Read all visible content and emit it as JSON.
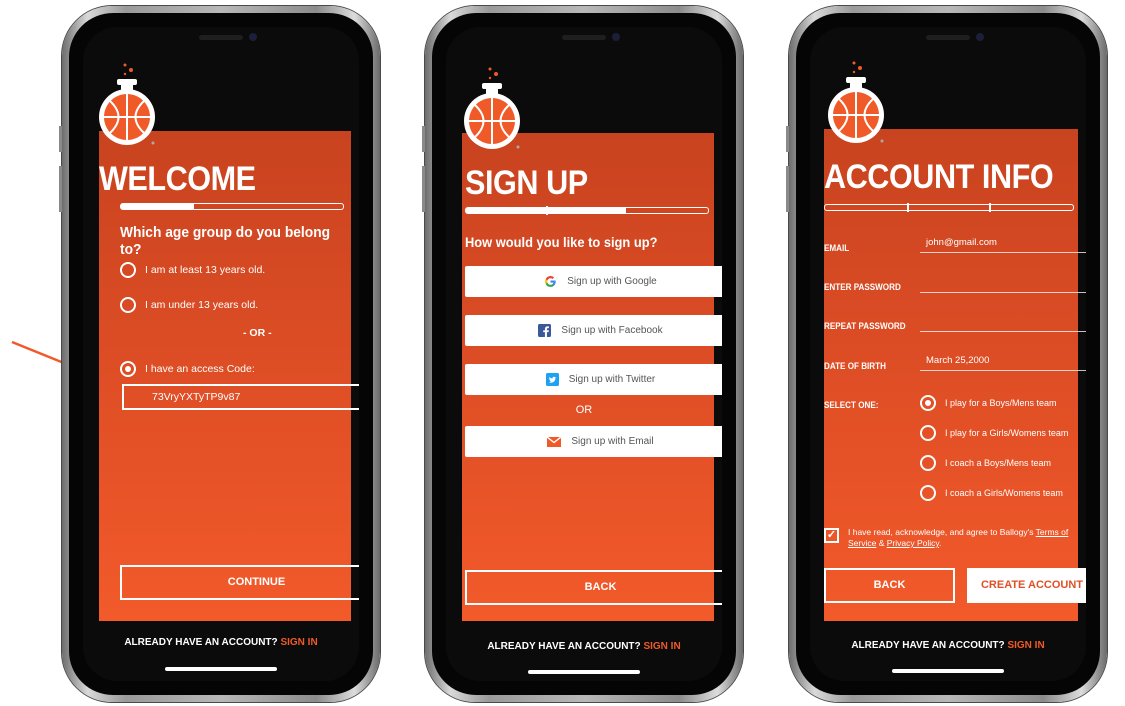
{
  "colors": {
    "accent": "#f05a28",
    "panel_top": "#c8431f",
    "panel_bottom": "#f25a2a"
  },
  "common": {
    "footer_prefix": "ALREADY HAVE AN ACCOUNT?",
    "footer_link": "SIGN IN"
  },
  "welcome": {
    "title": "WELCOME",
    "question": "Which age group do you belong to?",
    "options": [
      "I am at least 13 years old.",
      "I am under 13 years old."
    ],
    "or_label": "- OR -",
    "access_label": "I have an access Code:",
    "access_code": "73VryYXTyTP9v87",
    "continue": "CONTINUE",
    "progress": 0.33
  },
  "signup": {
    "title": "SIGN UP",
    "question": "How would you like to sign up?",
    "google": "Sign up with Google",
    "facebook": "Sign up with Facebook",
    "twitter": "Sign up with Twitter",
    "or_label": "OR",
    "email": "Sign up with Email",
    "back": "BACK",
    "progress": 0.66
  },
  "account": {
    "title": "ACCOUNT INFO",
    "email_label": "EMAIL",
    "email_value": "john@gmail.com",
    "password_label": "ENTER PASSWORD",
    "repeat_label": "REPEAT PASSWORD",
    "dob_label": "DATE OF BIRTH",
    "dob_value": "March 25,2000",
    "select_label": "SELECT ONE:",
    "options": [
      "I play for a Boys/Mens team",
      "I play for a Girls/Womens team",
      "I coach a Boys/Mens team",
      "I coach a Girls/Womens team"
    ],
    "terms_text": "I have read, acknowledge, and agree to Ballogy's",
    "terms_link": "Terms of Service",
    "amp": "&",
    "privacy_link": "Privacy Policy",
    "period": ".",
    "back": "BACK",
    "create": "CREATE ACCOUNT",
    "progress": 1.0
  }
}
